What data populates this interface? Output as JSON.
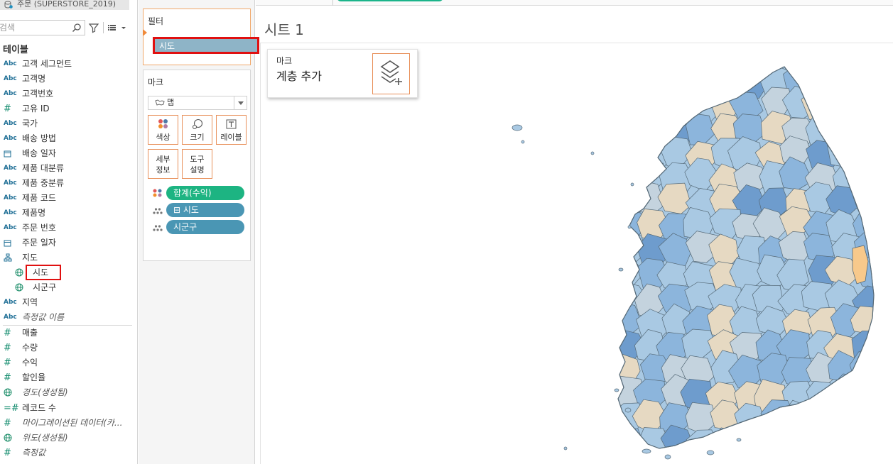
{
  "datasource": {
    "name": "주문 (SUPERSTORE_2019)"
  },
  "search": {
    "placeholder": "검색"
  },
  "data_pane": {
    "tables_label": "테이블",
    "dimensions": [
      {
        "type": "Abc",
        "name": "고객 세그먼트"
      },
      {
        "type": "Abc",
        "name": "고객명"
      },
      {
        "type": "Abc",
        "name": "고객번호"
      },
      {
        "type": "#",
        "name": "고유 ID"
      },
      {
        "type": "Abc",
        "name": "국가"
      },
      {
        "type": "Abc",
        "name": "배송 방법"
      },
      {
        "type": "date",
        "name": "배송 일자"
      },
      {
        "type": "Abc",
        "name": "제품 대분류"
      },
      {
        "type": "Abc",
        "name": "제품 중분류"
      },
      {
        "type": "Abc",
        "name": "제품 코드"
      },
      {
        "type": "Abc",
        "name": "제품명"
      },
      {
        "type": "Abc",
        "name": "주문 번호"
      },
      {
        "type": "date",
        "name": "주문 일자"
      },
      {
        "type": "hier",
        "name": "지도"
      },
      {
        "type": "globe",
        "name": "시도",
        "indent": true
      },
      {
        "type": "globe",
        "name": "시군구",
        "indent": true
      },
      {
        "type": "Abc",
        "name": "지역"
      },
      {
        "type": "Abc",
        "name": "측정값 이름",
        "italic": true
      }
    ],
    "measures": [
      {
        "type": "#",
        "name": "매출"
      },
      {
        "type": "#",
        "name": "수량"
      },
      {
        "type": "#",
        "name": "수익"
      },
      {
        "type": "#",
        "name": "할인율"
      },
      {
        "type": "globe",
        "name": "경도(생성됨)",
        "italic": true
      },
      {
        "type": "=#",
        "name": "레코드 수"
      },
      {
        "type": "#",
        "name": "마이그레이션된 데이터(카...",
        "italic": true
      },
      {
        "type": "globe",
        "name": "위도(생성됨)",
        "italic": true
      },
      {
        "type": "#",
        "name": "측정값",
        "italic": true
      }
    ]
  },
  "filters": {
    "title": "필터",
    "pill": "시도"
  },
  "marks": {
    "title": "마크",
    "mark_type": "맵",
    "buttons": {
      "color": "색상",
      "size": "크기",
      "label": "레이블",
      "detail": "세부\n정보",
      "tooltip": "도구\n설명"
    },
    "shelf": [
      {
        "label": "합계(수익)",
        "kind": "color",
        "color": "#1db482"
      },
      {
        "label": "⊟ 시도",
        "kind": "detail",
        "color": "#4a96b4"
      },
      {
        "label": "시군구",
        "kind": "detail",
        "color": "#4a96b4"
      }
    ]
  },
  "sheet": {
    "title": "시트 1"
  },
  "marks_overlay": {
    "title": "마크",
    "subtitle": "계층 추가"
  },
  "map_colors": {
    "light_blue": "#a9c9e3",
    "mid_blue": "#8cb5dc",
    "dark_blue": "#6e9ccd",
    "grey_blue": "#c4d3de",
    "beige": "#e6d9c2",
    "orange": "#f8c98b",
    "border": "#556977"
  }
}
